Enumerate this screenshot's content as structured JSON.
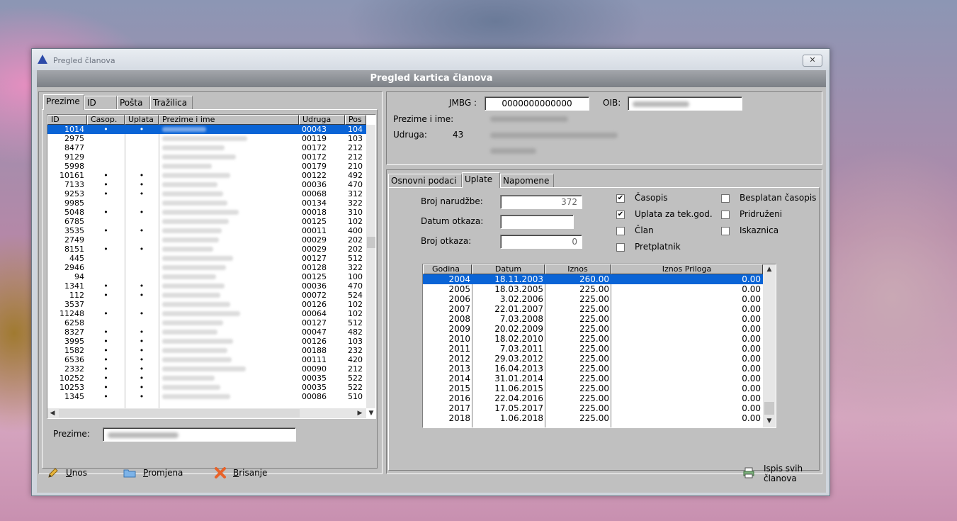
{
  "window": {
    "title": "Pregled članova",
    "close": "✕",
    "header": "Pregled kartica članova"
  },
  "left_tabs": [
    "Prezime",
    "ID",
    "Pošta",
    "Tražilica"
  ],
  "members_table": {
    "columns": [
      "ID",
      "Casop.",
      "Uplata",
      "Prezime i ime",
      "Udruga",
      "Pos"
    ],
    "rows": [
      {
        "id": "1014",
        "c": "•",
        "u": "•",
        "udruga": "00043",
        "pos": "104"
      },
      {
        "id": "2975",
        "c": "",
        "u": "",
        "udruga": "00119",
        "pos": "103"
      },
      {
        "id": "8477",
        "c": "",
        "u": "",
        "udruga": "00172",
        "pos": "212"
      },
      {
        "id": "9129",
        "c": "",
        "u": "",
        "udruga": "00172",
        "pos": "212"
      },
      {
        "id": "5998",
        "c": "",
        "u": "",
        "udruga": "00179",
        "pos": "210"
      },
      {
        "id": "10161",
        "c": "•",
        "u": "•",
        "udruga": "00122",
        "pos": "492"
      },
      {
        "id": "7133",
        "c": "•",
        "u": "•",
        "udruga": "00036",
        "pos": "470"
      },
      {
        "id": "9253",
        "c": "•",
        "u": "•",
        "udruga": "00068",
        "pos": "312"
      },
      {
        "id": "9985",
        "c": "",
        "u": "",
        "udruga": "00134",
        "pos": "322"
      },
      {
        "id": "5048",
        "c": "•",
        "u": "•",
        "udruga": "00018",
        "pos": "310"
      },
      {
        "id": "6785",
        "c": "",
        "u": "",
        "udruga": "00125",
        "pos": "102"
      },
      {
        "id": "3535",
        "c": "•",
        "u": "•",
        "udruga": "00011",
        "pos": "400"
      },
      {
        "id": "2749",
        "c": "",
        "u": "",
        "udruga": "00029",
        "pos": "202"
      },
      {
        "id": "8151",
        "c": "•",
        "u": "•",
        "udruga": "00029",
        "pos": "202"
      },
      {
        "id": "445",
        "c": "",
        "u": "",
        "udruga": "00127",
        "pos": "512"
      },
      {
        "id": "2946",
        "c": "",
        "u": "",
        "udruga": "00128",
        "pos": "322"
      },
      {
        "id": "94",
        "c": "",
        "u": "",
        "udruga": "00125",
        "pos": "100"
      },
      {
        "id": "1341",
        "c": "•",
        "u": "•",
        "udruga": "00036",
        "pos": "470"
      },
      {
        "id": "112",
        "c": "•",
        "u": "•",
        "udruga": "00072",
        "pos": "524"
      },
      {
        "id": "3537",
        "c": "",
        "u": "",
        "udruga": "00126",
        "pos": "102"
      },
      {
        "id": "11248",
        "c": "•",
        "u": "•",
        "udruga": "00064",
        "pos": "102"
      },
      {
        "id": "6258",
        "c": "",
        "u": "",
        "udruga": "00127",
        "pos": "512"
      },
      {
        "id": "8327",
        "c": "•",
        "u": "•",
        "udruga": "00047",
        "pos": "482"
      },
      {
        "id": "3995",
        "c": "•",
        "u": "•",
        "udruga": "00126",
        "pos": "103"
      },
      {
        "id": "1582",
        "c": "•",
        "u": "•",
        "udruga": "00188",
        "pos": "232"
      },
      {
        "id": "6536",
        "c": "•",
        "u": "•",
        "udruga": "00111",
        "pos": "420"
      },
      {
        "id": "2332",
        "c": "•",
        "u": "•",
        "udruga": "00090",
        "pos": "212"
      },
      {
        "id": "10252",
        "c": "•",
        "u": "•",
        "udruga": "00035",
        "pos": "522"
      },
      {
        "id": "10253",
        "c": "•",
        "u": "•",
        "udruga": "00035",
        "pos": "522"
      },
      {
        "id": "1345",
        "c": "•",
        "u": "•",
        "udruga": "00086",
        "pos": "510"
      }
    ]
  },
  "search": {
    "label": "Prezime:"
  },
  "info": {
    "jmbg_label": "JMBG :",
    "jmbg_value": "0000000000000",
    "oib_label": "OIB:",
    "name_label": "Prezime i ime:",
    "udruga_label": "Udruga:",
    "udruga_value": "43"
  },
  "right_tabs": [
    "Osnovni podaci",
    "Uplate",
    "Napomene"
  ],
  "uplate": {
    "broj_narudzbe_label": "Broj narudžbe:",
    "broj_narudzbe_value": "372",
    "datum_otkaza_label": "Datum otkaza:",
    "datum_otkaza_value": "",
    "broj_otkaza_label": "Broj otkaza:",
    "broj_otkaza_value": "0",
    "checkboxes": [
      {
        "label": "Časopis",
        "checked": true
      },
      {
        "label": "Uplata za tek.god.",
        "checked": true
      },
      {
        "label": "Član",
        "checked": false
      },
      {
        "label": "Pretplatnik",
        "checked": false
      },
      {
        "label": "Besplatan časopis",
        "checked": false
      },
      {
        "label": "Pridruženi",
        "checked": false
      },
      {
        "label": "Iskaznica",
        "checked": false
      }
    ],
    "check_mark": "✔"
  },
  "payments": {
    "columns": [
      "Godina",
      "Datum",
      "Iznos",
      "Iznos Priloga"
    ],
    "rows": [
      [
        "2004",
        "18.11.2003",
        "260.00",
        "0.00"
      ],
      [
        "2005",
        "18.03.2005",
        "225.00",
        "0.00"
      ],
      [
        "2006",
        "3.02.2006",
        "225.00",
        "0.00"
      ],
      [
        "2007",
        "22.01.2007",
        "225.00",
        "0.00"
      ],
      [
        "2008",
        "7.03.2008",
        "225.00",
        "0.00"
      ],
      [
        "2009",
        "20.02.2009",
        "225.00",
        "0.00"
      ],
      [
        "2010",
        "18.02.2010",
        "225.00",
        "0.00"
      ],
      [
        "2011",
        "7.03.2011",
        "225.00",
        "0.00"
      ],
      [
        "2012",
        "29.03.2012",
        "225.00",
        "0.00"
      ],
      [
        "2013",
        "16.04.2013",
        "225.00",
        "0.00"
      ],
      [
        "2014",
        "31.01.2014",
        "225.00",
        "0.00"
      ],
      [
        "2015",
        "11.06.2015",
        "225.00",
        "0.00"
      ],
      [
        "2016",
        "22.04.2016",
        "225.00",
        "0.00"
      ],
      [
        "2017",
        "17.05.2017",
        "225.00",
        "0.00"
      ],
      [
        "2018",
        "1.06.2018",
        "225.00",
        "0.00"
      ]
    ]
  },
  "buttons": {
    "unos_u": "U",
    "unos_rest": "nos",
    "promjena_u": "P",
    "promjena_rest": "romjena",
    "brisanje_u": "B",
    "brisanje_rest": "risanje",
    "ispis_line1": "Ispis svih",
    "ispis_line2": "članova"
  },
  "scroll": {
    "up": "▲",
    "down": "▼",
    "left": "◀",
    "right": "▶"
  },
  "colors": {
    "selection": "#0a64d6",
    "header": "#8a8e94"
  }
}
